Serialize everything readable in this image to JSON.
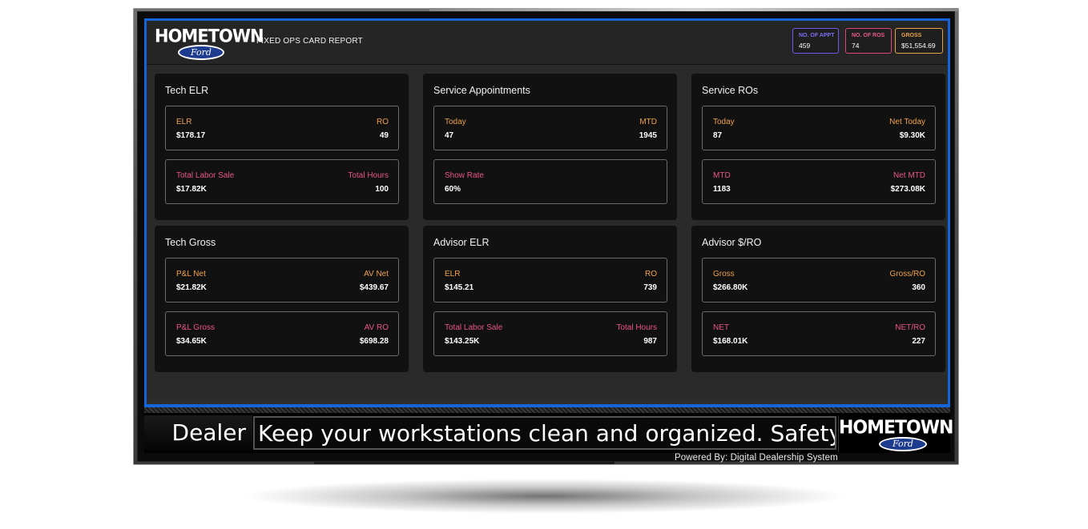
{
  "brand": {
    "logo_word": "HOMETOWN",
    "logo_badge": "Ford"
  },
  "header": {
    "title": "FIXED OPS CARD REPORT",
    "kpis": [
      {
        "label": "NO. OF APPT",
        "value": "459",
        "color": "#7c6ff5"
      },
      {
        "label": "NO. OF ROS",
        "value": "74",
        "color": "#e85a8c"
      },
      {
        "label": "GROSS",
        "value": "$51,554.69",
        "color": "#e8a24a"
      }
    ]
  },
  "colors": {
    "accent_blue": "#1565d8",
    "label_orange": "#f0a14c",
    "label_pink": "#ea5585"
  },
  "panels": [
    {
      "title": "Tech ELR",
      "metrics": [
        {
          "left_label": "ELR",
          "left_value": "$178.17",
          "right_label": "RO",
          "right_value": "49",
          "color": "orange"
        },
        {
          "left_label": "Total Labor Sale",
          "left_value": "$17.82K",
          "right_label": "Total Hours",
          "right_value": "100",
          "color": "pink"
        }
      ]
    },
    {
      "title": "Service Appointments",
      "metrics": [
        {
          "left_label": "Today",
          "left_value": "47",
          "right_label": "MTD",
          "right_value": "1945",
          "color": "orange"
        },
        {
          "left_label": "Show Rate",
          "left_value": "60%",
          "right_label": "",
          "right_value": "",
          "color": "pink"
        }
      ]
    },
    {
      "title": "Service ROs",
      "metrics": [
        {
          "left_label": "Today",
          "left_value": "87",
          "right_label": "Net Today",
          "right_value": "$9.30K",
          "color": "orange"
        },
        {
          "left_label": "MTD",
          "left_value": "1183",
          "right_label": "Net MTD",
          "right_value": "$273.08K",
          "color": "pink"
        }
      ]
    },
    {
      "title": "Tech Gross",
      "metrics": [
        {
          "left_label": "P&L Net",
          "left_value": "$21.82K",
          "right_label": "AV Net",
          "right_value": "$439.67",
          "color": "orange"
        },
        {
          "left_label": "P&L Gross",
          "left_value": "$34.65K",
          "right_label": "AV RO",
          "right_value": "$698.28",
          "color": "pink"
        }
      ]
    },
    {
      "title": "Advisor ELR",
      "metrics": [
        {
          "left_label": "ELR",
          "left_value": "$145.21",
          "right_label": "RO",
          "right_value": "739",
          "color": "orange"
        },
        {
          "left_label": "Total Labor Sale",
          "left_value": "$143.25K",
          "right_label": "Total Hours",
          "right_value": "987",
          "color": "pink"
        }
      ]
    },
    {
      "title": "Advisor $/RO",
      "metrics": [
        {
          "left_label": "Gross",
          "left_value": "$266.80K",
          "right_label": "Gross/RO",
          "right_value": "360",
          "color": "orange"
        },
        {
          "left_label": "NET",
          "left_value": "$168.01K",
          "right_label": "NET/RO",
          "right_value": "227",
          "color": "pink"
        }
      ]
    }
  ],
  "ticker": {
    "label": "Dealer",
    "message": "Keep your workstations clean and organized. Safety Firs"
  },
  "footer": {
    "powered_by": "Powered By: Digital Dealership System"
  }
}
